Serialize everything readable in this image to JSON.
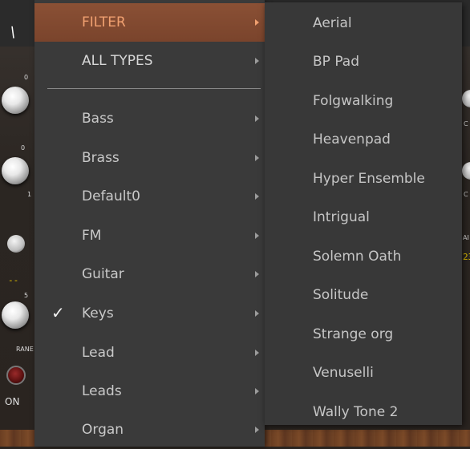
{
  "background": {
    "yellow_readout_left": "--",
    "yellow_readout_right": "23",
    "label_range": "RANE",
    "label_on": "ON",
    "label_ai": "AI",
    "label_c": "C",
    "knob_scale_top": "0",
    "knob_scale_mid": "0",
    "knob_scale_low": "5",
    "knob_scale_side": "1"
  },
  "colors": {
    "menu_bg": "#3a3a3a",
    "submenu_bg": "#383838",
    "highlight_bg": "#7f4830",
    "highlight_text": "#f0a070",
    "item_text": "#c9c9c9"
  },
  "main_menu": {
    "filter_item": {
      "label": "FILTER",
      "has_submenu": true,
      "highlighted": true
    },
    "all_types_item": {
      "label": "ALL TYPES",
      "has_submenu": true
    },
    "items": [
      {
        "label": "Bass",
        "has_submenu": true,
        "checked": false
      },
      {
        "label": "Brass",
        "has_submenu": true,
        "checked": false
      },
      {
        "label": "Default0",
        "has_submenu": true,
        "checked": false
      },
      {
        "label": "FM",
        "has_submenu": true,
        "checked": false
      },
      {
        "label": "Guitar",
        "has_submenu": true,
        "checked": false
      },
      {
        "label": "Keys",
        "has_submenu": true,
        "checked": true
      },
      {
        "label": "Lead",
        "has_submenu": true,
        "checked": false
      },
      {
        "label": "Leads",
        "has_submenu": true,
        "checked": false
      },
      {
        "label": "Organ",
        "has_submenu": true,
        "checked": false
      }
    ],
    "check_glyph": "✓"
  },
  "sub_menu": {
    "items": [
      "Aerial",
      "BP Pad",
      "Folgwalking",
      "Heavenpad",
      "Hyper Ensemble",
      "Intrigual",
      "Solemn Oath",
      "Solitude",
      "Strange org",
      "Venuselli",
      "Wally Tone 2"
    ]
  }
}
